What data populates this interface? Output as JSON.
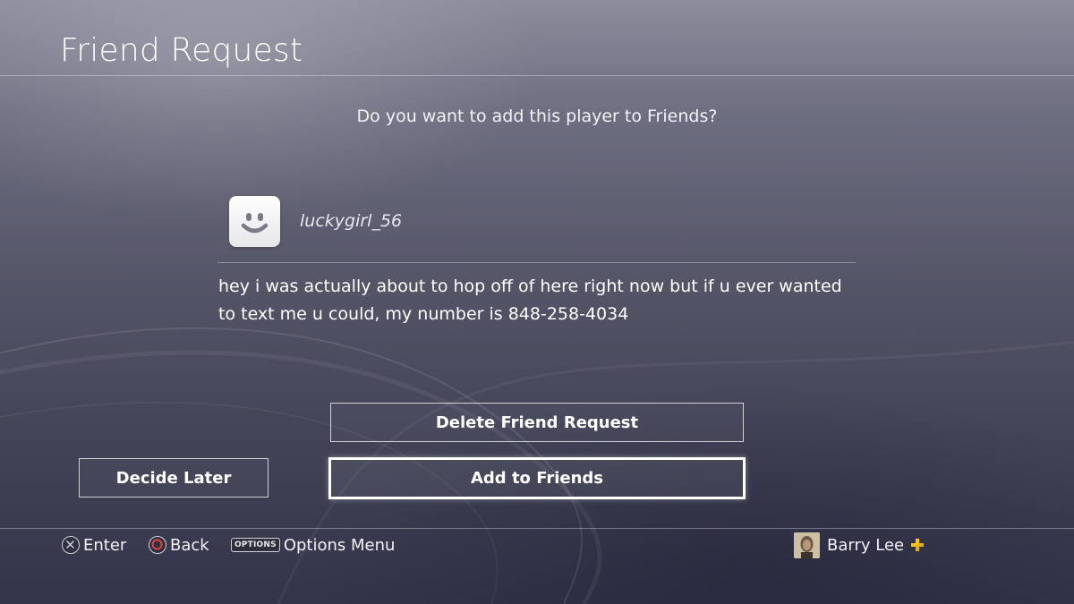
{
  "header": {
    "title": "Friend Request"
  },
  "dialog": {
    "prompt": "Do you want to add this player to Friends?",
    "sender": {
      "username": "luckygirl_56",
      "avatar_icon": "smiley-face-icon"
    },
    "message": "hey i was actually about to hop off of here right now but if u ever wanted to text me u could, my number is 848-258-4034"
  },
  "buttons": {
    "delete_label": "Delete Friend Request",
    "later_label": "Decide Later",
    "add_label": "Add to Friends"
  },
  "footer": {
    "enter_label": "Enter",
    "enter_icon": "cross-button-icon",
    "back_label": "Back",
    "back_icon": "circle-button-icon",
    "options_key": "OPTIONS",
    "options_label": "Options Menu",
    "user_name": "Barry Lee",
    "plus_icon": "playstation-plus-icon"
  },
  "colors": {
    "background_top": "#8c8c9c",
    "background_bottom": "#33344a",
    "text": "#ffffff",
    "circle_button": "#e0443a",
    "plus_badge": "#f5c518"
  }
}
